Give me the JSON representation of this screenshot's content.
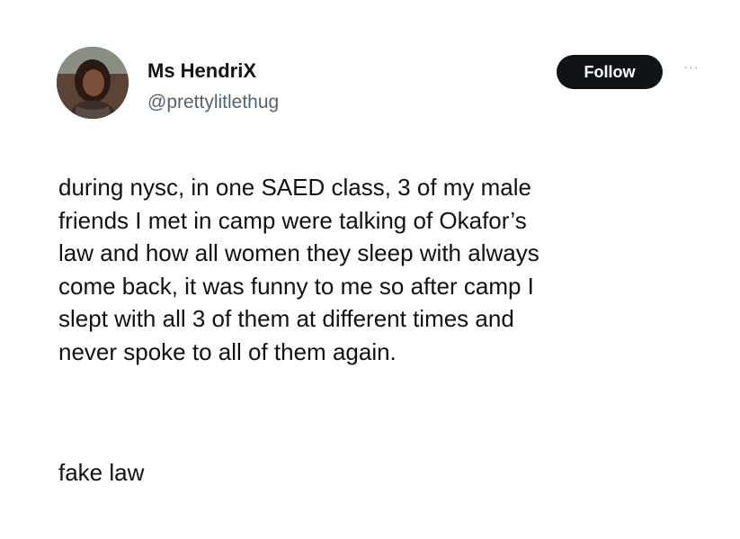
{
  "user": {
    "display_name": "Ms HendriX",
    "handle": "@prettylitlethug",
    "avatar_icon": "profile-photo"
  },
  "actions": {
    "follow_label": "Follow",
    "more_icon": "ellipsis-icon",
    "more_glyph": "···"
  },
  "tweet": {
    "lines": [
      "during nysc, in one SAED class, 3 of my male",
      "friends I met in camp were talking of Okafor’s",
      "law and how all women they sleep with always",
      "come back, it was funny to me so after camp I",
      "slept with all 3 of them at different times and",
      "never spoke to all of them again."
    ],
    "tail": "fake law"
  },
  "colors": {
    "follow_bg": "#0f1419",
    "follow_text": "#ffffff",
    "handle": "#536471",
    "text": "#111111"
  }
}
